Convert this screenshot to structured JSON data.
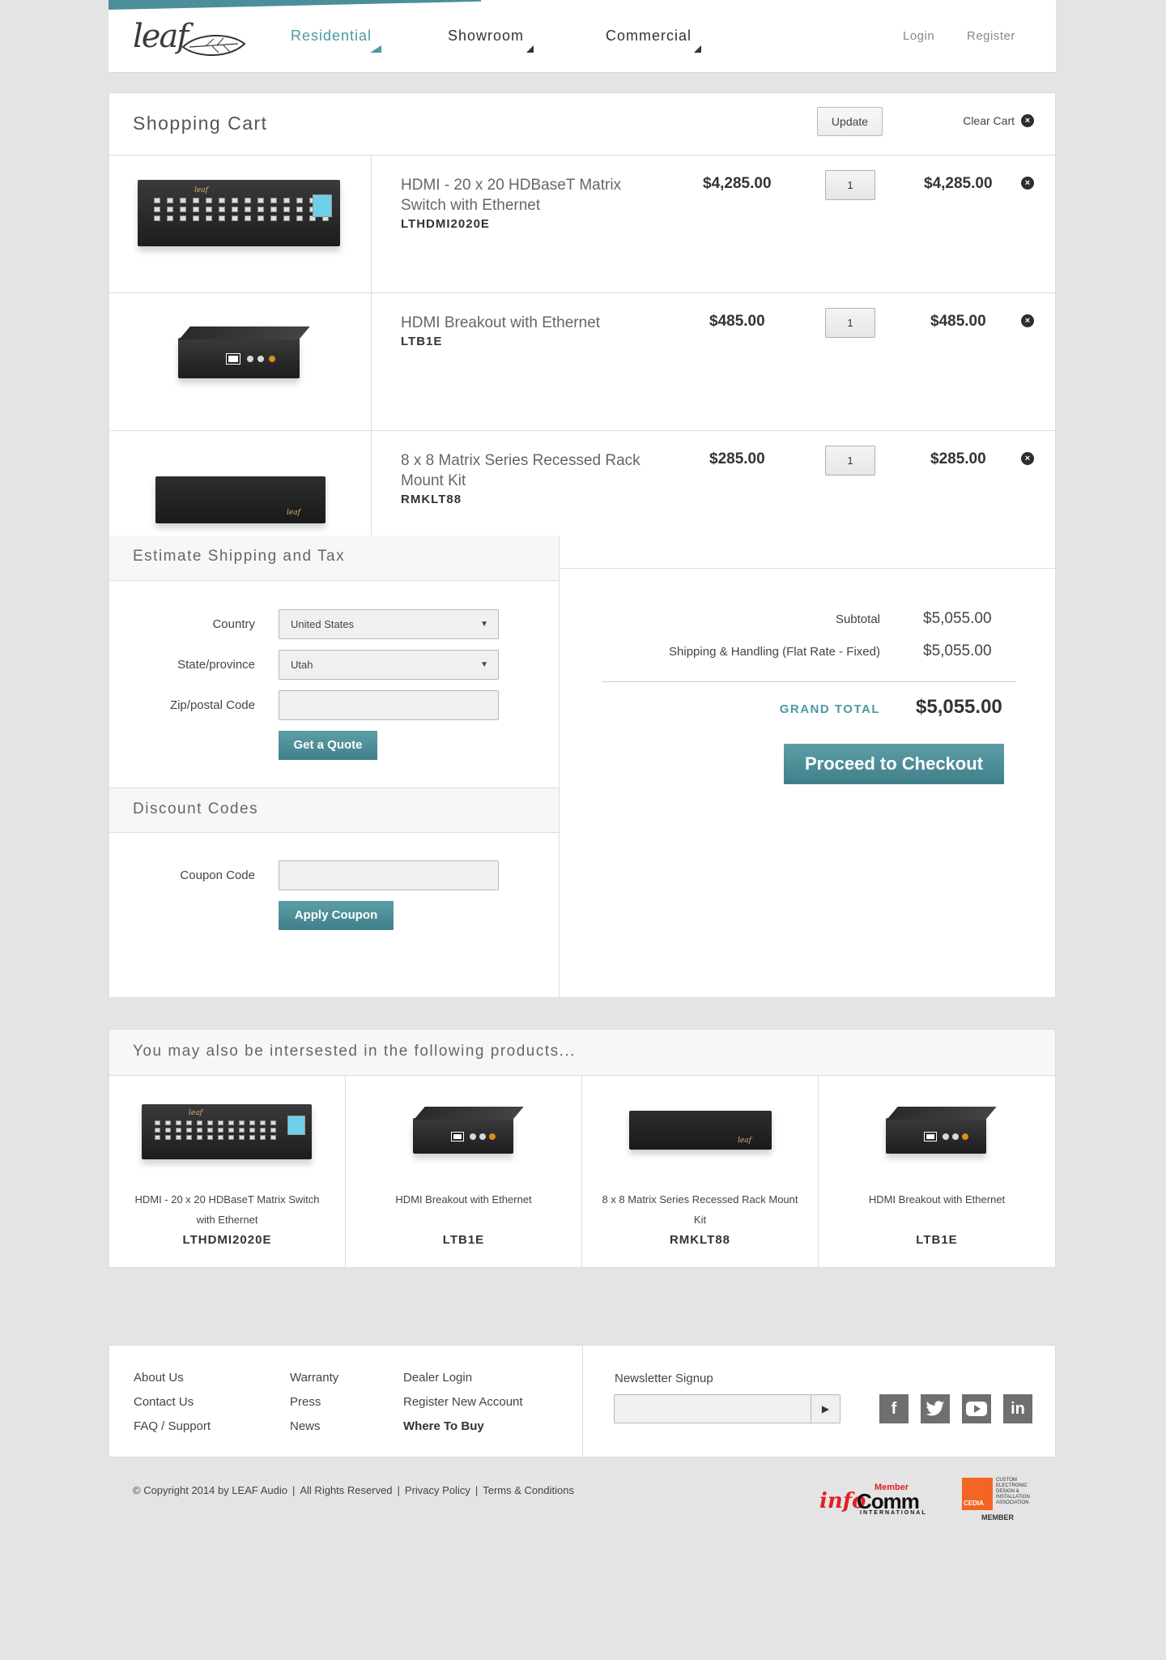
{
  "header": {
    "logo": "leaf",
    "nav": [
      {
        "label": "Residential",
        "active": true
      },
      {
        "label": "Showroom",
        "active": false
      },
      {
        "label": "Commercial",
        "active": false
      }
    ],
    "login": "Login",
    "register": "Register"
  },
  "cart": {
    "title": "Shopping Cart",
    "update_label": "Update",
    "clear_label": "Clear Cart",
    "items": [
      {
        "name": "HDMI - 20 x 20 HDBaseT Matrix Switch with Ethernet",
        "sku": "LTHDMI2020E",
        "price": "$4,285.00",
        "qty": "1",
        "total": "$4,285.00"
      },
      {
        "name": "HDMI Breakout with Ethernet",
        "sku": "LTB1E",
        "price": "$485.00",
        "qty": "1",
        "total": "$485.00"
      },
      {
        "name": "8 x 8 Matrix Series Recessed Rack Mount Kit",
        "sku": "RMKLT88",
        "price": "$285.00",
        "qty": "1",
        "total": "$285.00"
      }
    ]
  },
  "shipping": {
    "title": "Estimate Shipping and Tax",
    "country_label": "Country",
    "country_value": "United States",
    "state_label": "State/province",
    "state_value": "Utah",
    "zip_label": "Zip/postal Code",
    "zip_value": "",
    "quote_label": "Get a Quote"
  },
  "discount": {
    "title": "Discount Codes",
    "coupon_label": "Coupon Code",
    "coupon_value": "",
    "apply_label": "Apply Coupon"
  },
  "totals": {
    "subtotal_label": "Subtotal",
    "subtotal_value": "$5,055.00",
    "shipping_label": "Shipping & Handling (Flat Rate - Fixed)",
    "shipping_value": "$5,055.00",
    "grand_label": "GRAND TOTAL",
    "grand_value": "$5,055.00",
    "checkout_label": "Proceed to Checkout"
  },
  "related": {
    "title": "You may also be intersested in the following products...",
    "items": [
      {
        "name": "HDMI - 20 x 20 HDBaseT Matrix Switch with Ethernet",
        "sku": "LTHDMI2020E"
      },
      {
        "name": "HDMI Breakout with Ethernet",
        "sku": "LTB1E"
      },
      {
        "name": "8 x 8 Matrix Series Recessed Rack Mount Kit",
        "sku": "RMKLT88"
      },
      {
        "name": "HDMI Breakout with Ethernet",
        "sku": "LTB1E"
      }
    ]
  },
  "footer": {
    "col1": [
      "About Us",
      "Contact Us",
      "FAQ / Support"
    ],
    "col2": [
      "Warranty",
      "Press",
      "News"
    ],
    "col3": [
      "Dealer Login",
      "Register New Account",
      "Where To Buy"
    ],
    "newsletter_label": "Newsletter Signup",
    "newsletter_value": "",
    "social": [
      "facebook-icon",
      "twitter-icon",
      "youtube-icon",
      "linkedin-icon"
    ],
    "copyright": "© Copyright 2014 by LEAF Audio",
    "rights": "All Rights Reserved",
    "privacy": "Privacy Policy",
    "terms": "Terms & Conditions",
    "infocomm": {
      "member": "Member",
      "info": "info",
      "comm": "Comm",
      "intl": "INTERNATIONAL"
    },
    "cedia": {
      "name": "CEDIA",
      "desc": "CUSTOM ELECTRONIC DESIGN & INSTALLATION ASSOCIATION",
      "member": "MEMBER"
    }
  },
  "colors": {
    "accent": "#4a8f99",
    "button": "#4a8a94",
    "brand_red": "#e02026",
    "cedia_orange": "#f26522"
  }
}
